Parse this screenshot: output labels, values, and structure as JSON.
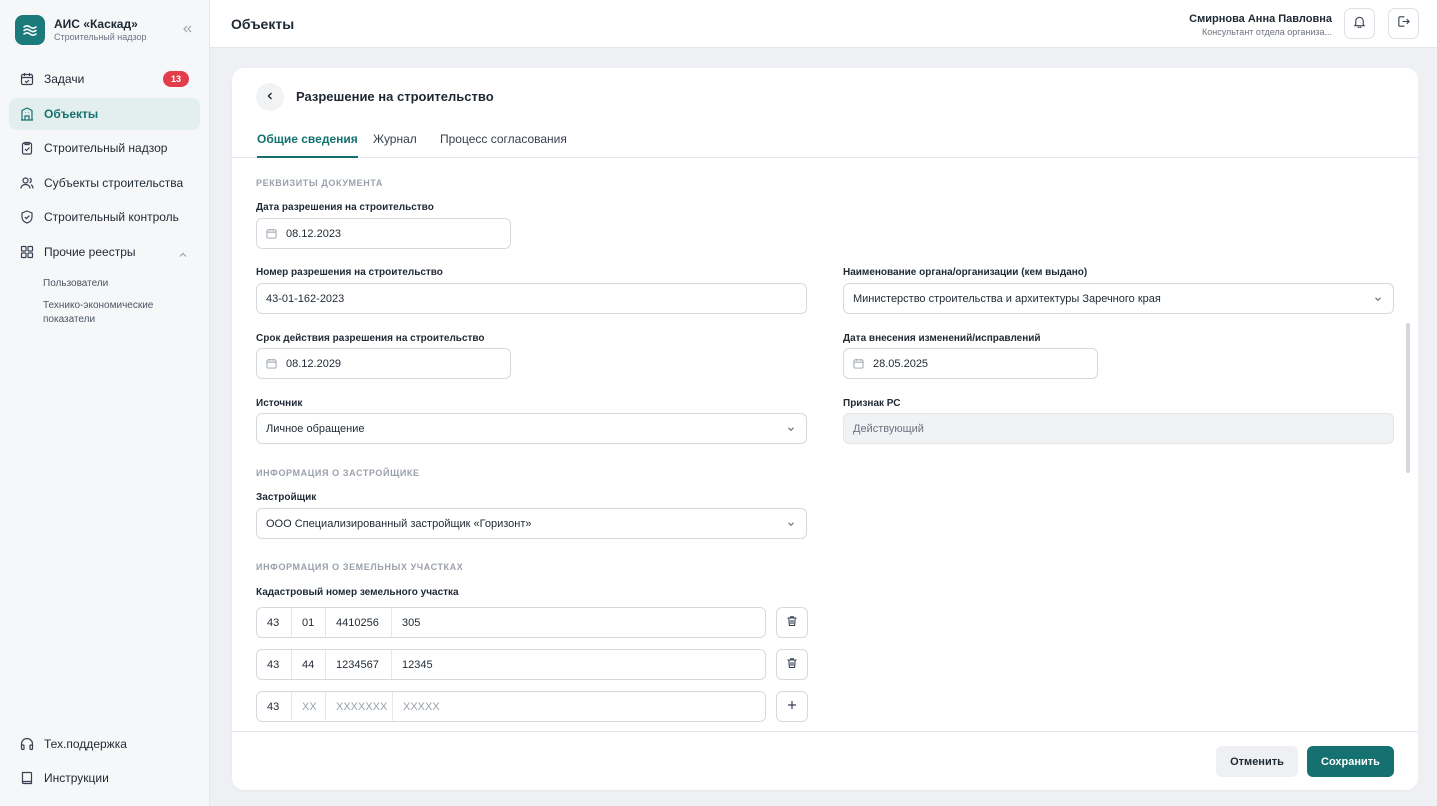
{
  "app": {
    "title": "АИС «Каскад»",
    "subtitle": "Строительный надзор"
  },
  "sidebar": {
    "items": [
      {
        "label": "Задачи",
        "icon": "calendar-check-icon",
        "badge": "13"
      },
      {
        "label": "Объекты",
        "icon": "building-icon",
        "active": true
      },
      {
        "label": "Строительный надзор",
        "icon": "clipboard-check-icon"
      },
      {
        "label": "Субъекты строительства",
        "icon": "users-icon"
      },
      {
        "label": "Строительный контроль",
        "icon": "shield-check-icon"
      },
      {
        "label": "Прочие реестры",
        "icon": "grid-icon",
        "expanded": true
      }
    ],
    "subitems": [
      {
        "label": "Пользователи"
      },
      {
        "label": "Технико-экономические показатели"
      }
    ],
    "bottom": [
      {
        "label": "Тех.поддержка",
        "icon": "headphones-icon"
      },
      {
        "label": "Инструкции",
        "icon": "book-icon"
      }
    ]
  },
  "header": {
    "title": "Объекты",
    "user_name": "Смирнова Анна Павловна",
    "user_role": "Консультант отдела организа..."
  },
  "card": {
    "title": "Разрешение на строительство",
    "tabs": [
      {
        "label": "Общие сведения",
        "active": true
      },
      {
        "label": "Журнал"
      },
      {
        "label": "Процесс согласования"
      }
    ]
  },
  "form": {
    "section_document": "РЕКВИЗИТЫ ДОКУМЕНТА",
    "permit_date": {
      "label": "Дата разрешения на строительство",
      "value": "08.12.2023"
    },
    "permit_number": {
      "label": "Номер разрешения на строительство",
      "value": "43-01-162-2023"
    },
    "issuer": {
      "label": "Наименование органа/организации (кем выдано)",
      "value": "Министерство строительства и архитектуры Заречного края"
    },
    "valid_until": {
      "label": "Срок действия разрешения на строительство",
      "value": "08.12.2029"
    },
    "changes_date": {
      "label": "Дата внесения изменений/исправлений",
      "value": "28.05.2025"
    },
    "source": {
      "label": "Источник",
      "value": "Личное обращение"
    },
    "status": {
      "label": "Признак РС",
      "value": "Действующий"
    },
    "section_developer": "ИНФОРМАЦИЯ О ЗАСТРОЙЩИКЕ",
    "developer": {
      "label": "Застройщик",
      "value": "ООО Специализированный застройщик «Горизонт»"
    },
    "section_land": "ИНФОРМАЦИЯ О ЗЕМЕЛЬНЫХ УЧАСТКАХ",
    "cadastral_label": "Кадастровый номер земельного участка",
    "cadastral_rows": [
      {
        "parts": [
          "43",
          "01",
          "4410256",
          "305"
        ]
      },
      {
        "parts": [
          "43",
          "44",
          "1234567",
          "12345"
        ]
      }
    ],
    "cadastral_new": {
      "region": "43",
      "placeholders": [
        "XX",
        "XXXXXXX",
        "XXXXX"
      ]
    }
  },
  "footer": {
    "cancel_label": "Отменить",
    "save_label": "Сохранить"
  },
  "colors": {
    "accent": "#14716f",
    "badge": "#e23d4b",
    "active_bg": "#e3efee"
  }
}
